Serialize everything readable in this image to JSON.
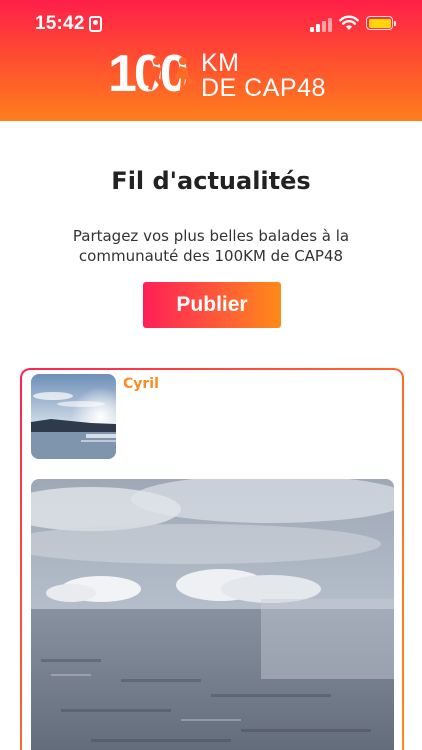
{
  "status_bar": {
    "time": "15:42"
  },
  "header": {
    "logo_number": "100",
    "logo_line1": "KM",
    "logo_line2": "DE CAP48"
  },
  "page": {
    "title": "Fil d'actualités",
    "intro": "Partagez vos plus belles balades à la communauté des 100KM de CAP48",
    "publish_label": "Publier"
  },
  "post": {
    "author": "Cyril"
  },
  "colors": {
    "brand_red": "#ff1f49",
    "brand_orange": "#ff8a18",
    "author_name": "#ff8a1d"
  }
}
